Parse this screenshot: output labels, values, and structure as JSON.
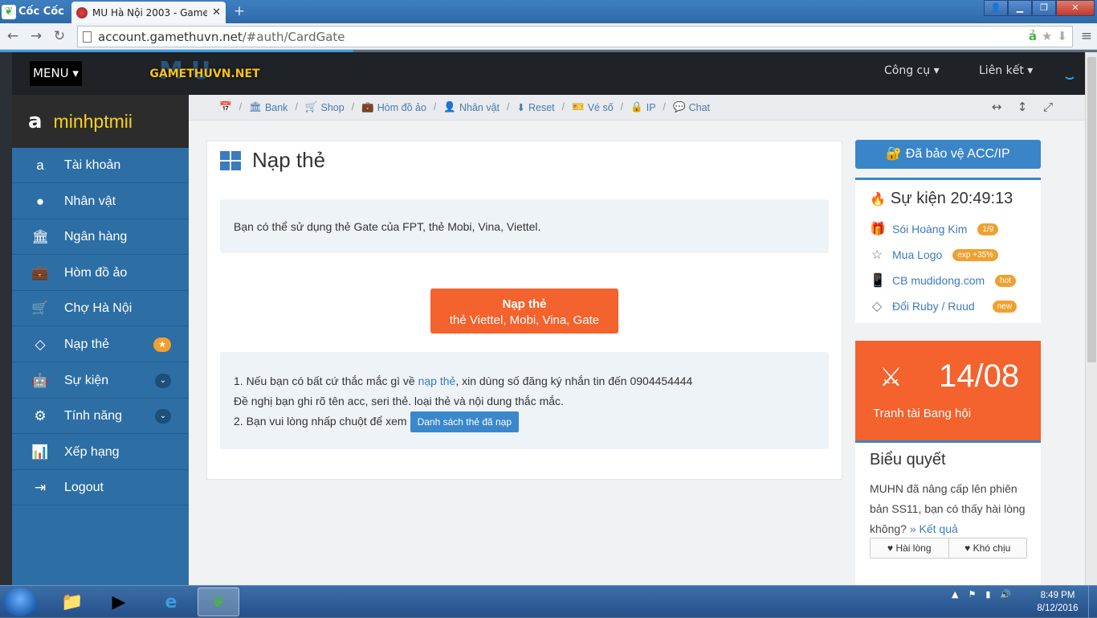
{
  "browser": {
    "brand": "Cốc Cốc",
    "tab_title": "MU Hà Nội 2003 - Gameth",
    "tab_close": "✕",
    "url_host": "account.gamethuvn.net",
    "url_path": "/#auth/CardGate"
  },
  "header": {
    "menu_label": "MENU ▾",
    "logo_text": "GAMETHUVN.NET",
    "logo_mark": "MU",
    "nav": [
      "Công cụ ▾",
      "Liên kết ▾"
    ]
  },
  "sidebar": {
    "username": "minhptmii",
    "items": [
      {
        "label": "Tài khoản",
        "icon": "amazon-icon"
      },
      {
        "label": "Nhân vật",
        "icon": "user-icon"
      },
      {
        "label": "Ngân hàng",
        "icon": "bank-icon"
      },
      {
        "label": "Hòm đồ ảo",
        "icon": "suitcase-icon"
      },
      {
        "label": "Chợ Hà Nội",
        "icon": "cart-icon"
      },
      {
        "label": "Nạp thẻ",
        "icon": "diamond-icon",
        "badge": "★"
      },
      {
        "label": "Sự kiện",
        "icon": "android-icon",
        "chevron": "⌄"
      },
      {
        "label": "Tính năng",
        "icon": "gears-icon",
        "chevron": "⌄"
      },
      {
        "label": "Xếp hạng",
        "icon": "bar-chart-icon"
      },
      {
        "label": "Logout",
        "icon": "sign-out-icon"
      }
    ]
  },
  "breadcrumbs": [
    {
      "label": "",
      "icon": "calendar-icon"
    },
    {
      "label": "Bank",
      "icon": "bank-icon"
    },
    {
      "label": "Shop",
      "icon": "cart-icon"
    },
    {
      "label": "Hòm đồ ảo",
      "icon": "suitcase-icon"
    },
    {
      "label": "Nhân vật",
      "icon": "user-icon"
    },
    {
      "label": "Reset",
      "icon": "download-icon"
    },
    {
      "label": "Vé số",
      "icon": "ticket-icon"
    },
    {
      "label": "IP",
      "icon": "lock-icon"
    },
    {
      "label": "Chat",
      "icon": "comment-icon"
    }
  ],
  "main": {
    "title": "Nạp thẻ",
    "info": "Bạn có thể sử dụng thẻ Gate của FPT, thẻ Mobi, Vina, Viettel.",
    "button_title": "Nạp thẻ",
    "button_sub": "thẻ Viettel, Mobi, Vina, Gate",
    "help_line1_a": "1. Nếu bạn có bất cứ thắc mắc gì về ",
    "help_line1_link": "nạp thẻ",
    "help_line1_b": ", xin dùng số đăng ký nhắn tin đến 0904454444",
    "help_line2": "Đề nghị bạn ghi rõ tên acc, seri thẻ. loại thẻ và nội dung thắc mắc.",
    "help_line3": "2. Bạn vui lòng nhấp chuột để xem",
    "list_button": "Danh sách thẻ đã nạp"
  },
  "right": {
    "protect_button": "Đã bảo vệ ACC/IP",
    "event_title": "Sự kiện 20:49:13",
    "events": [
      {
        "label": "Sói Hoàng Kim",
        "badge": "1/9",
        "icon": "gift-icon"
      },
      {
        "label": "Mua Logo",
        "badge": "exp +35%",
        "icon": "star-icon"
      },
      {
        "label": "CB mudidong.com",
        "badge": "hot",
        "icon": "mobile-icon"
      },
      {
        "label": "Đổi Ruby / Ruud",
        "badge": "new",
        "icon": "diamond-icon"
      }
    ],
    "promo_date": "14/08",
    "promo_label": "Tranh tài Bang hội",
    "poll_title": "Biểu quyết",
    "poll_text": "MUHN đã nâng cấp lên phiên bản SS11, bạn có thấy hài lòng không?",
    "poll_link": "» Kết quả",
    "poll_yes": "Hài lòng",
    "poll_no": "Khó chịu"
  },
  "taskbar": {
    "time": "8:49 PM",
    "date": "8/12/2016"
  },
  "colors": {
    "accent": "#f4622d",
    "primary": "#3a85c8",
    "sidebar": "#2d6ea5",
    "username": "#f7d21e"
  }
}
